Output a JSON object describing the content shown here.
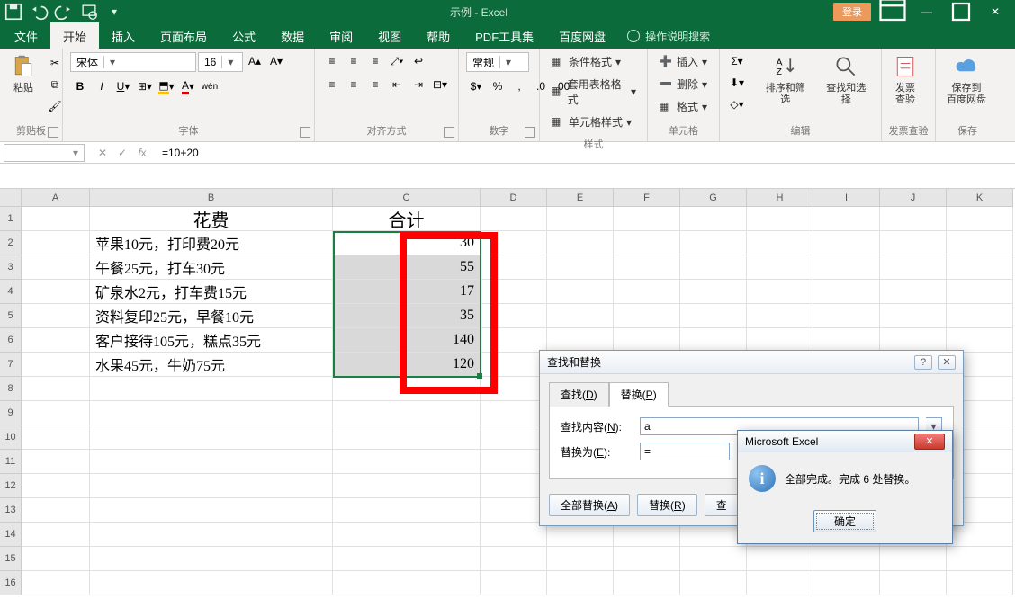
{
  "app": {
    "title": "示例 - Excel",
    "login": "登录"
  },
  "tabs": {
    "file": "文件",
    "home": "开始",
    "insert": "插入",
    "layout": "页面布局",
    "formulas": "公式",
    "data": "数据",
    "review": "审阅",
    "view": "视图",
    "help": "帮助",
    "pdf": "PDF工具集",
    "baidu": "百度网盘",
    "tellme": "操作说明搜索"
  },
  "ribbon": {
    "clipboard": {
      "paste": "粘贴",
      "label": "剪贴板"
    },
    "font": {
      "name": "宋体",
      "size": "16",
      "label": "字体"
    },
    "align": {
      "label": "对齐方式"
    },
    "number": {
      "format": "常规",
      "label": "数字"
    },
    "styles": {
      "cond": "条件格式",
      "table": "套用表格格式",
      "cell": "单元格样式",
      "label": "样式"
    },
    "cells": {
      "insert": "插入",
      "delete": "删除",
      "format": "格式",
      "label": "单元格"
    },
    "editing": {
      "sort": "排序和筛选",
      "find": "查找和选择",
      "label": "编辑"
    },
    "invoice": {
      "cap": "发票\n查验",
      "label": "发票查验"
    },
    "save": {
      "cap": "保存到\n百度网盘",
      "label": "保存"
    }
  },
  "namebox": "",
  "formula": "=10+20",
  "columns": [
    "A",
    "B",
    "C",
    "D",
    "E",
    "F",
    "G",
    "H",
    "I",
    "J",
    "K"
  ],
  "rows": [
    "1",
    "2",
    "3",
    "4",
    "5",
    "6",
    "7",
    "8",
    "9",
    "10",
    "11",
    "12",
    "13",
    "14",
    "15",
    "16"
  ],
  "sheet": {
    "B1": "花费",
    "C1": "合计",
    "B2": "苹果10元，打印费20元",
    "C2": "30",
    "B3": "午餐25元，打车30元",
    "C3": "55",
    "B4": "矿泉水2元，打车费15元",
    "C4": "17",
    "B5": "资料复印25元，早餐10元",
    "C5": "35",
    "B6": "客户接待105元，糕点35元",
    "C6": "140",
    "B7": "水果45元，牛奶75元",
    "C7": "120"
  },
  "dialog": {
    "title": "查找和替换",
    "tab_find": "查找(D)",
    "tab_replace": "替换(P)",
    "find_label": "查找内容(N):",
    "find_value": "a",
    "replace_label": "替换为(E):",
    "replace_value": "=",
    "btn_replace_all": "全部替换(A)",
    "btn_replace": "替换(R)",
    "btn_find_partial": "查"
  },
  "alert": {
    "title": "Microsoft Excel",
    "msg": "全部完成。完成 6 处替换。",
    "ok": "确定"
  }
}
